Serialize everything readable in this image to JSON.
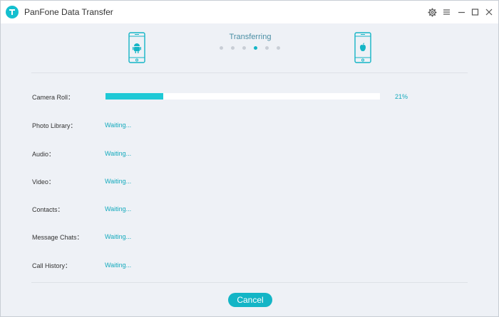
{
  "window": {
    "title": "PanFone Data Transfer"
  },
  "colors": {
    "accent": "#14b5c6",
    "progress": "#1fc9d6",
    "status_text": "#14aabd"
  },
  "transfer": {
    "status": "Transferring",
    "step_count": 6,
    "active_step": 4,
    "source_device_icon": "android-phone-icon",
    "target_device_icon": "apple-phone-icon"
  },
  "rows": [
    {
      "label": "Camera Roll：",
      "type": "progress",
      "progress": 0.21,
      "percent_text": "21%"
    },
    {
      "label": "Photo Library：",
      "type": "status",
      "status": "Waiting..."
    },
    {
      "label": "Audio：",
      "type": "status",
      "status": "Waiting..."
    },
    {
      "label": "Video：",
      "type": "status",
      "status": "Waiting..."
    },
    {
      "label": "Contacts：",
      "type": "status",
      "status": "Waiting..."
    },
    {
      "label": "Message Chats：",
      "type": "status",
      "status": "Waiting..."
    },
    {
      "label": "Call History：",
      "type": "status",
      "status": "Waiting..."
    }
  ],
  "footer": {
    "cancel_label": "Cancel"
  }
}
